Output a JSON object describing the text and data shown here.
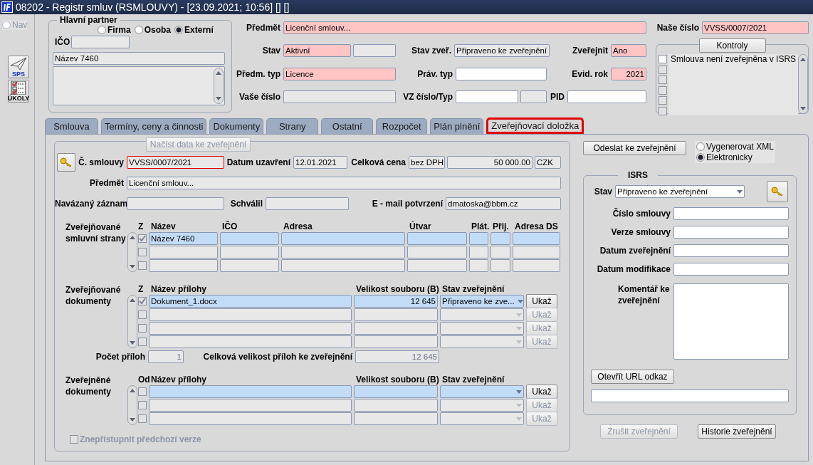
{
  "window": {
    "title": "08202 - Registr smluv (RSMLOUVY) - [23.09.2021; 10:56] [] []"
  },
  "sidebar": {
    "nav": {
      "label": "Nav",
      "selected": false
    },
    "buttons": [
      {
        "label": "SPS",
        "kind": "plane"
      },
      {
        "label": "ÚKOLY",
        "kind": "checklist"
      }
    ]
  },
  "partner": {
    "title": "Hlavní partner",
    "types": [
      {
        "label": "Firma",
        "selected": false
      },
      {
        "label": "Osoba",
        "selected": false
      },
      {
        "label": "Externí",
        "selected": true
      }
    ],
    "ico_label": "IČO",
    "name": "Název 7460"
  },
  "header": {
    "rows": [
      [
        {
          "label": "Předmět",
          "boxes": [
            {
              "value": "Licenční smlouv...",
              "kind": "required"
            }
          ]
        }
      ],
      [
        {
          "label": "Stav",
          "boxes": [
            {
              "value": "Aktivní",
              "kind": "required"
            },
            {
              "kind": "readonly"
            }
          ]
        },
        {
          "label": "Stav zveř.",
          "boxes": [
            {
              "value": "Připraveno ke zveřejnění",
              "kind": "readonly"
            }
          ]
        },
        {
          "label": "Zveřejnit",
          "boxes": [
            {
              "value": "Ano",
              "kind": "required"
            }
          ]
        }
      ],
      [
        {
          "label": "Předm. typ",
          "boxes": [
            {
              "value": "Licence",
              "kind": "required"
            }
          ]
        },
        {
          "label": "Práv. typ",
          "boxes": [
            {
              "kind": "editable"
            }
          ]
        },
        {
          "label": "Evid. rok",
          "boxes": [
            {
              "value": "2021",
              "kind": "required"
            }
          ]
        }
      ],
      [
        {
          "label": "Vaše číslo",
          "boxes": [
            {
              "kind": "readonly"
            }
          ]
        },
        {
          "label": "VZ číslo/Typ",
          "boxes": [
            {
              "kind": "editable"
            },
            {
              "kind": "readonly"
            }
          ]
        },
        {
          "label": "PID",
          "boxes": [
            {
              "kind": "editable"
            }
          ]
        }
      ]
    ]
  },
  "our_number": {
    "label": "Naše číslo",
    "value": "VVSS/0007/2021",
    "kind": "required"
  },
  "checks": {
    "button": "Kontroly",
    "items": [
      {
        "label": "Smlouva není zveřejněna v ISRS",
        "checked": false,
        "disabled": false
      },
      {
        "checked": false,
        "disabled": true
      },
      {
        "checked": false,
        "disabled": true
      },
      {
        "checked": false,
        "disabled": true
      },
      {
        "checked": false,
        "disabled": true
      },
      {
        "checked": false,
        "disabled": true
      }
    ]
  },
  "tabs": [
    {
      "label": "Smlouva",
      "selected": false
    },
    {
      "label": "Termíny, ceny a činnosti",
      "selected": false
    },
    {
      "label": "Dokumenty",
      "selected": false
    },
    {
      "label": "Strany",
      "selected": false
    },
    {
      "label": "Ostatní",
      "selected": false
    },
    {
      "label": "Rozpočet",
      "selected": false
    },
    {
      "label": "Plán plnění",
      "selected": false
    },
    {
      "label": "Zveřejňovací doložka",
      "selected": true
    }
  ],
  "publication": {
    "load_button": {
      "label": "Načíst data ke zveřejnění",
      "disabled": true
    },
    "rows": [
      [
        {
          "label": "Č. smlouvy",
          "boxes": [
            {
              "value": "VVSS/0007/2021",
              "kind": "focused"
            }
          ]
        },
        {
          "label": "Datum uzavření",
          "boxes": [
            {
              "value": "12.01.2021",
              "kind": "readonly"
            }
          ]
        },
        {
          "label": "Celková cena",
          "boxes": [
            {
              "value": "bez DPH",
              "kind": "readonly"
            },
            {
              "value": "50 000.00",
              "kind": "readonly"
            },
            {
              "value": "CZK",
              "kind": "readonly"
            }
          ]
        }
      ],
      [
        {
          "label": "Předmět",
          "boxes": [
            {
              "value": "Licenční smlouv...",
              "kind": "readonly"
            }
          ]
        }
      ],
      [
        {
          "label": "Navázaný záznam",
          "boxes": [
            {
              "kind": "readonly"
            }
          ]
        },
        {
          "label": "Schválil",
          "boxes": [
            {
              "kind": "readonly"
            }
          ]
        },
        {
          "label": "E - mail potvrzení",
          "boxes": [
            {
              "value": "dmatoska@bbm.cz",
              "kind": "readonly"
            }
          ]
        }
      ]
    ],
    "parties": {
      "label": "Zveřejňované smluvní strany",
      "columns": [
        "Z",
        "Název",
        "IČO",
        "Adresa",
        "Útvar",
        "Plát.",
        "Přij.",
        "Adresa DS"
      ],
      "rows": [
        {
          "selected": true,
          "checked": true,
          "cells": [
            "Název 7460"
          ]
        },
        {
          "selected": false,
          "checked": false
        },
        {
          "selected": false,
          "checked": false
        }
      ]
    },
    "documents": {
      "label": "Zveřejňované dokumenty",
      "columns": [
        "Z",
        "Název přílohy",
        "Velikost souboru (B)",
        "Stav zveřejnění"
      ],
      "rows": [
        {
          "selected": true,
          "checked": true,
          "cells": [
            "Dokument_1.docx",
            "12 645",
            "Připraveno ke zve..."
          ],
          "button": {
            "label": "Ukaž",
            "disabled": false
          }
        },
        {
          "selected": false,
          "checked": false,
          "button": {
            "label": "Ukaž",
            "disabled": true
          }
        },
        {
          "selected": false,
          "checked": false,
          "button": {
            "label": "Ukaž",
            "disabled": true
          }
        },
        {
          "selected": false,
          "checked": false,
          "button": {
            "label": "Ukaž",
            "disabled": true
          }
        }
      ]
    },
    "attachment_count": {
      "label": "Počet příloh",
      "value": "1"
    },
    "total_size": {
      "label": "Celková velikost příloh ke zveřejnění",
      "value": "12 645"
    },
    "published": {
      "label": "Zveřejněné dokumenty",
      "columns": [
        "Od",
        "Název přílohy",
        "Velikost souboru (B)",
        "Stav zveřejnění"
      ],
      "rows": [
        {
          "selected": true,
          "checked": false,
          "button": {
            "label": "Ukaž",
            "disabled": false
          }
        },
        {
          "selected": false,
          "checked": false,
          "button": {
            "label": "Ukaž",
            "disabled": true
          }
        },
        {
          "selected": false,
          "checked": false,
          "button": {
            "label": "Ukaž",
            "disabled": true
          }
        }
      ]
    },
    "hide_previous": {
      "label": "Znepřístupnit předchozí verze",
      "checked": false,
      "disabled": true
    },
    "send_button": {
      "label": "Odeslat ke zveřejnění",
      "disabled": false
    },
    "mode": [
      {
        "label": "Vygenerovat XML",
        "selected": false
      },
      {
        "label": "Elektronicky",
        "selected": true
      }
    ],
    "isrs": {
      "title": "ISRS",
      "status": {
        "label": "Stav",
        "value": "Připraveno ke zveřejnění"
      },
      "fields": [
        {
          "label": "Číslo smlouvy"
        },
        {
          "label": "Verze smlouvy"
        },
        {
          "label": "Datum zveřejnění"
        },
        {
          "label": "Datum modifikace"
        }
      ],
      "comment": {
        "label": "Komentář ke zveřejnění"
      },
      "url_button": {
        "label": "Otevřít URL odkaz",
        "disabled": false
      }
    },
    "buttons": [
      {
        "label": "Zrušit zveřejnění",
        "disabled": true
      },
      {
        "label": "Historie zveřejnění",
        "disabled": false
      }
    ]
  }
}
